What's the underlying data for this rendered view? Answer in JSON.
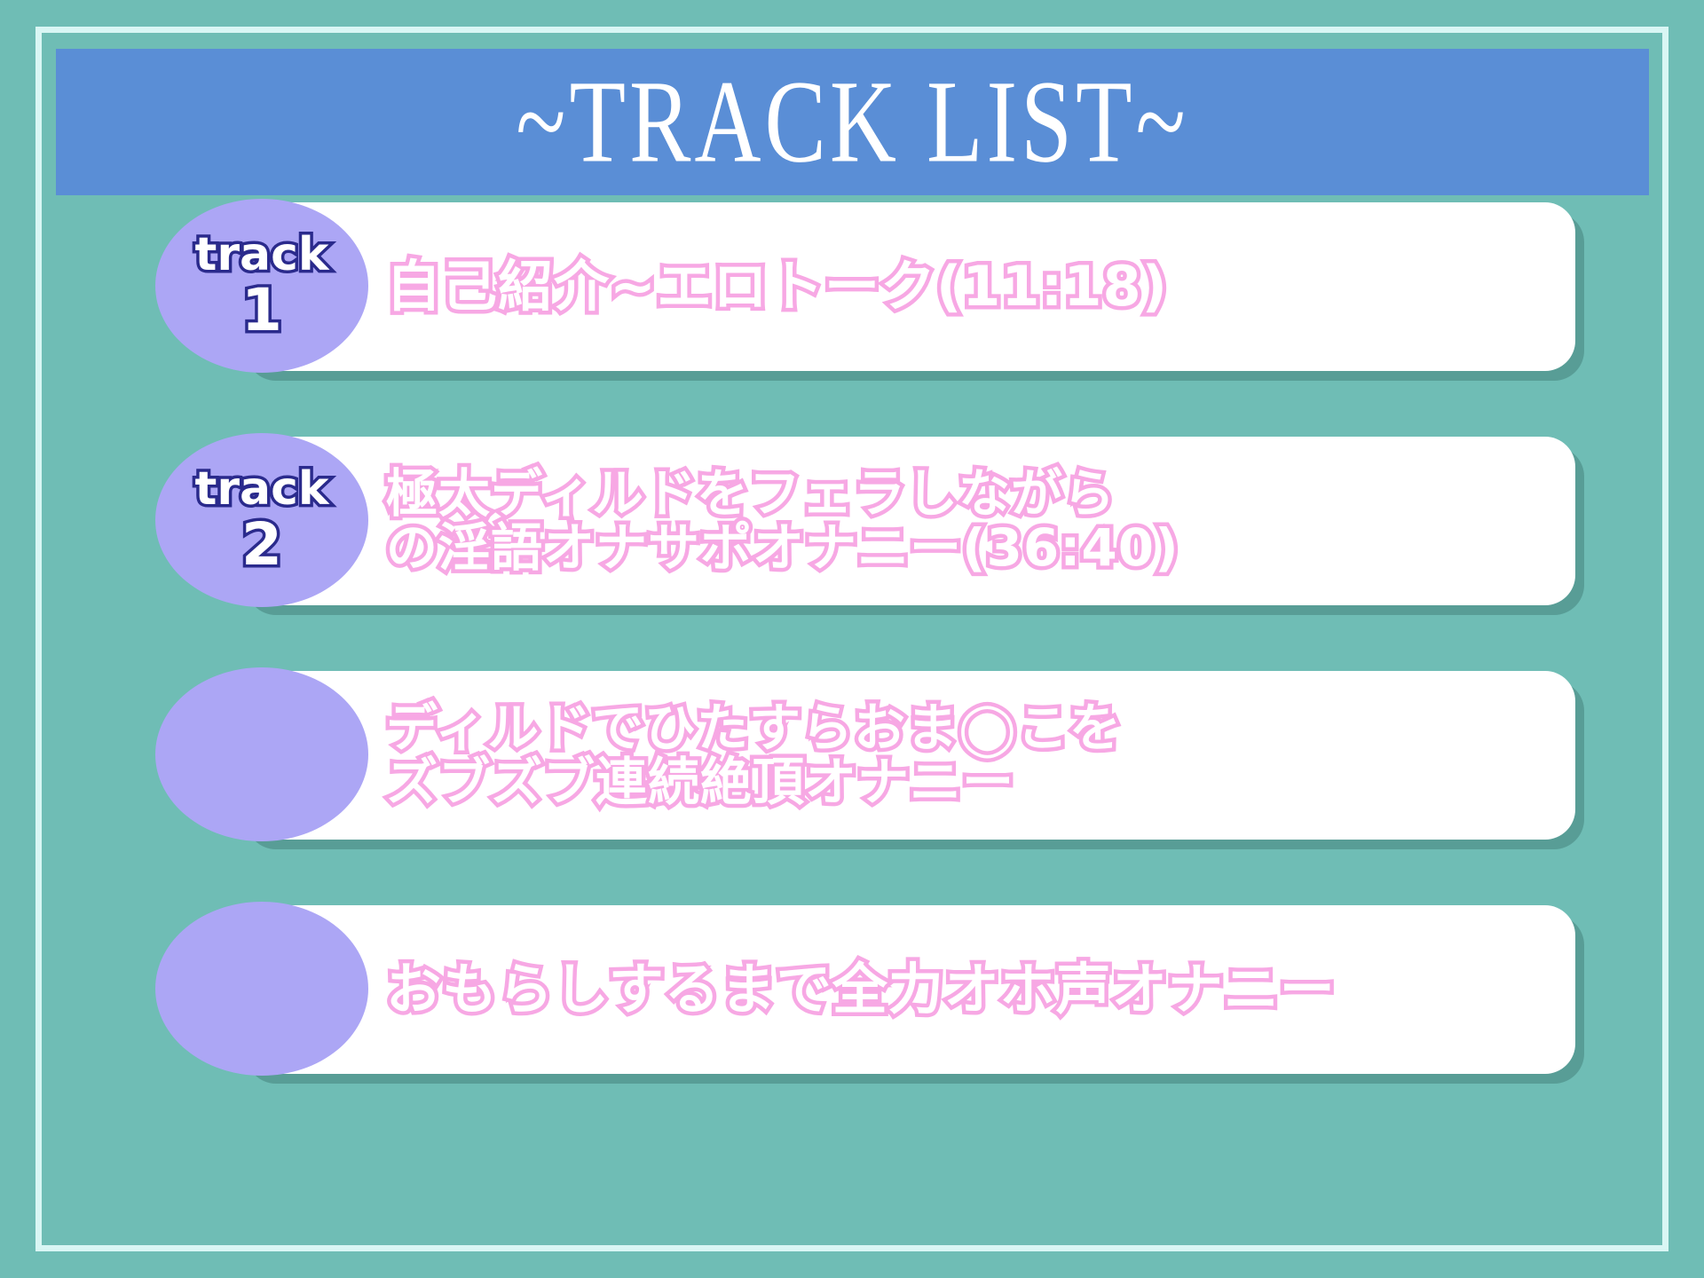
{
  "header": {
    "title": "~TRACK LIST~",
    "bar_color": "#5a8ed6",
    "title_color": "#ffffff"
  },
  "theme": {
    "background": "#6fbdb5",
    "frame_border": "#d9f6f4",
    "card_background": "#ffffff",
    "badge_color": "#aca6f5",
    "badge_text_color": "#ffffff",
    "badge_outline_color": "#2a2a8c",
    "track_text_color": "#ffffff",
    "track_text_outline_color": "#f7a8e4",
    "card_shadow_color": "#3c7670"
  },
  "tracks": [
    {
      "badge_word": "track",
      "badge_number": "1",
      "lines": [
        "自己紹介~エロトーク(11:18)"
      ],
      "duration": "11:18"
    },
    {
      "badge_word": "track",
      "badge_number": "2",
      "lines": [
        "極太ディルドをフェラしながら",
        "の淫語オナサポオナニー(36:40)"
      ],
      "duration": "36:40"
    },
    {
      "badge_word": "",
      "badge_number": "",
      "lines": [
        "ディルドでひたすらおま◯こを",
        "ズブズブ連続絶頂オナニー"
      ],
      "duration": ""
    },
    {
      "badge_word": "",
      "badge_number": "",
      "lines": [
        "おもらしするまで全力オホ声オナニー"
      ],
      "duration": ""
    }
  ]
}
